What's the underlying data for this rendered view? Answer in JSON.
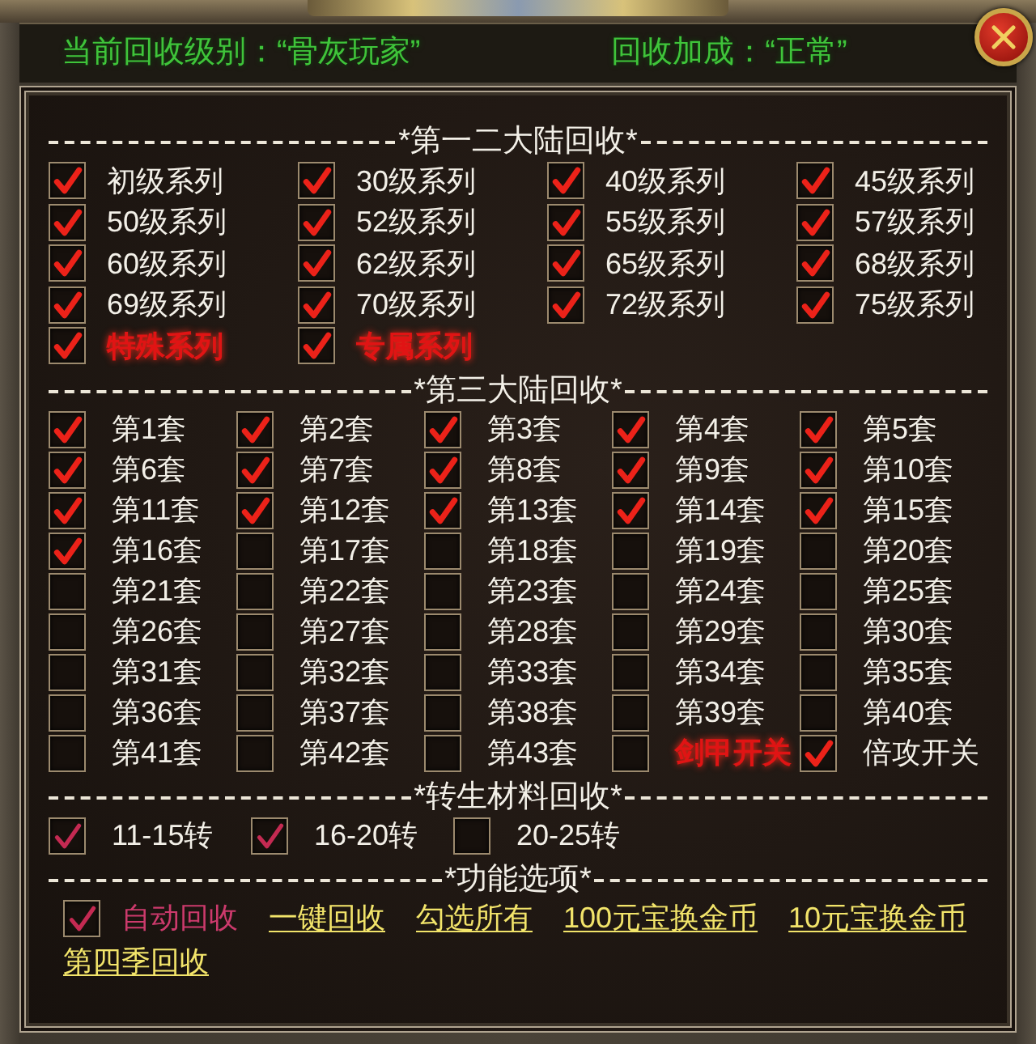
{
  "status": {
    "recycle_level": "当前回收级别：“骨灰玩家”",
    "recycle_bonus": "回收加成：“正常”"
  },
  "sections": [
    {
      "kind": "series",
      "title": "*第一二大陆回收*",
      "items": [
        {
          "label": "初级系列",
          "checked": true,
          "kind": "normal"
        },
        {
          "label": "30级系列",
          "checked": true,
          "kind": "normal"
        },
        {
          "label": "40级系列",
          "checked": true,
          "kind": "normal"
        },
        {
          "label": "45级系列",
          "checked": true,
          "kind": "normal"
        },
        {
          "label": "50级系列",
          "checked": true,
          "kind": "normal"
        },
        {
          "label": "52级系列",
          "checked": true,
          "kind": "normal"
        },
        {
          "label": "55级系列",
          "checked": true,
          "kind": "normal"
        },
        {
          "label": "57级系列",
          "checked": true,
          "kind": "normal"
        },
        {
          "label": "60级系列",
          "checked": true,
          "kind": "normal"
        },
        {
          "label": "62级系列",
          "checked": true,
          "kind": "normal"
        },
        {
          "label": "65级系列",
          "checked": true,
          "kind": "normal"
        },
        {
          "label": "68级系列",
          "checked": true,
          "kind": "normal"
        },
        {
          "label": "69级系列",
          "checked": true,
          "kind": "normal"
        },
        {
          "label": "70级系列",
          "checked": true,
          "kind": "normal"
        },
        {
          "label": "72级系列",
          "checked": true,
          "kind": "normal"
        },
        {
          "label": "75级系列",
          "checked": true,
          "kind": "normal"
        },
        {
          "label": "特殊系列",
          "checked": true,
          "kind": "special"
        },
        {
          "label": "专属系列",
          "checked": true,
          "kind": "special"
        }
      ]
    },
    {
      "kind": "sets",
      "title": "*第三大陆回收*",
      "items": [
        {
          "label": "第1套",
          "checked": true,
          "kind": "normal"
        },
        {
          "label": "第2套",
          "checked": true,
          "kind": "normal"
        },
        {
          "label": "第3套",
          "checked": true,
          "kind": "normal"
        },
        {
          "label": "第4套",
          "checked": true,
          "kind": "normal"
        },
        {
          "label": "第5套",
          "checked": true,
          "kind": "normal"
        },
        {
          "label": "第6套",
          "checked": true,
          "kind": "normal"
        },
        {
          "label": "第7套",
          "checked": true,
          "kind": "normal"
        },
        {
          "label": "第8套",
          "checked": true,
          "kind": "normal"
        },
        {
          "label": "第9套",
          "checked": true,
          "kind": "normal"
        },
        {
          "label": "第10套",
          "checked": true,
          "kind": "normal"
        },
        {
          "label": "第11套",
          "checked": true,
          "kind": "normal"
        },
        {
          "label": "第12套",
          "checked": true,
          "kind": "normal"
        },
        {
          "label": "第13套",
          "checked": true,
          "kind": "normal"
        },
        {
          "label": "第14套",
          "checked": true,
          "kind": "normal"
        },
        {
          "label": "第15套",
          "checked": true,
          "kind": "normal"
        },
        {
          "label": "第16套",
          "checked": true,
          "kind": "normal"
        },
        {
          "label": "第17套",
          "checked": false,
          "kind": "normal"
        },
        {
          "label": "第18套",
          "checked": false,
          "kind": "normal"
        },
        {
          "label": "第19套",
          "checked": false,
          "kind": "normal"
        },
        {
          "label": "第20套",
          "checked": false,
          "kind": "normal"
        },
        {
          "label": "第21套",
          "checked": false,
          "kind": "normal"
        },
        {
          "label": "第22套",
          "checked": false,
          "kind": "normal"
        },
        {
          "label": "第23套",
          "checked": false,
          "kind": "normal"
        },
        {
          "label": "第24套",
          "checked": false,
          "kind": "normal"
        },
        {
          "label": "第25套",
          "checked": false,
          "kind": "normal"
        },
        {
          "label": "第26套",
          "checked": false,
          "kind": "normal"
        },
        {
          "label": "第27套",
          "checked": false,
          "kind": "normal"
        },
        {
          "label": "第28套",
          "checked": false,
          "kind": "normal"
        },
        {
          "label": "第29套",
          "checked": false,
          "kind": "normal"
        },
        {
          "label": "第30套",
          "checked": false,
          "kind": "normal"
        },
        {
          "label": "第31套",
          "checked": false,
          "kind": "normal"
        },
        {
          "label": "第32套",
          "checked": false,
          "kind": "normal"
        },
        {
          "label": "第33套",
          "checked": false,
          "kind": "normal"
        },
        {
          "label": "第34套",
          "checked": false,
          "kind": "normal"
        },
        {
          "label": "第35套",
          "checked": false,
          "kind": "normal"
        },
        {
          "label": "第36套",
          "checked": false,
          "kind": "normal"
        },
        {
          "label": "第37套",
          "checked": false,
          "kind": "normal"
        },
        {
          "label": "第38套",
          "checked": false,
          "kind": "normal"
        },
        {
          "label": "第39套",
          "checked": false,
          "kind": "normal"
        },
        {
          "label": "第40套",
          "checked": false,
          "kind": "normal"
        },
        {
          "label": "第41套",
          "checked": false,
          "kind": "normal"
        },
        {
          "label": "第42套",
          "checked": false,
          "kind": "normal"
        },
        {
          "label": "第43套",
          "checked": false,
          "kind": "normal"
        },
        {
          "label": "剑甲开关",
          "checked": false,
          "kind": "special"
        },
        {
          "label": "倍攻开关",
          "checked": true,
          "kind": "normal"
        }
      ]
    },
    {
      "kind": "materials",
      "title": "*转生材料回收*",
      "items": [
        {
          "label": "11-15转",
          "checked": true,
          "kind": "normal"
        },
        {
          "label": "16-20转",
          "checked": true,
          "kind": "normal"
        },
        {
          "label": "20-25转",
          "checked": false,
          "kind": "normal"
        }
      ]
    },
    {
      "kind": "functions",
      "title": "*功能选项*",
      "items": [
        {
          "label": "自动回收",
          "checked": true,
          "kind": "toggle"
        },
        {
          "label": "一键回收",
          "kind": "link"
        },
        {
          "label": "勾选所有",
          "kind": "link"
        },
        {
          "label": "100元宝换金币",
          "kind": "link"
        },
        {
          "label": "10元宝换金币",
          "kind": "link"
        },
        {
          "label": "第四季回收",
          "kind": "link"
        }
      ]
    }
  ]
}
